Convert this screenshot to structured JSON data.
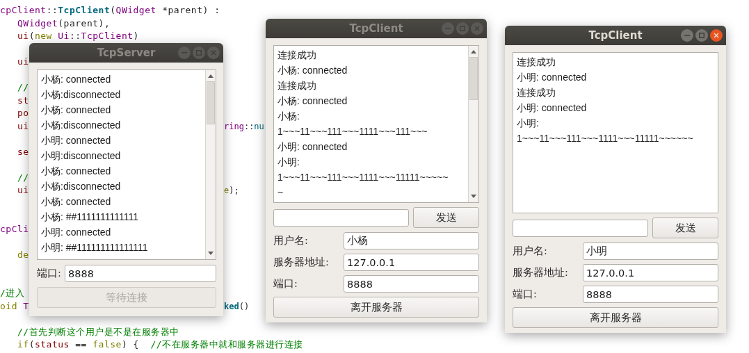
{
  "code_editor": {
    "lines": [
      {
        "kind": "code",
        "tokens": [
          {
            "text": "cpClient",
            "kind": "type"
          },
          {
            "text": "::",
            "kind": "plain"
          },
          {
            "text": "TcpClient",
            "kind": "func"
          },
          {
            "text": "(",
            "kind": "plain"
          },
          {
            "text": "QWidget",
            "kind": "type"
          },
          {
            "text": " *parent) :",
            "kind": "plain"
          }
        ]
      },
      {
        "kind": "code",
        "tokens": [
          {
            "text": "   QWidget",
            "kind": "type"
          },
          {
            "text": "(parent),",
            "kind": "plain"
          }
        ]
      },
      {
        "kind": "code",
        "tokens": [
          {
            "text": "   ui",
            "kind": "member"
          },
          {
            "text": "(",
            "kind": "plain"
          },
          {
            "text": "new ",
            "kind": "keyword"
          },
          {
            "text": "Ui",
            "kind": "type"
          },
          {
            "text": "::",
            "kind": "plain"
          },
          {
            "text": "TcpClient",
            "kind": "type"
          },
          {
            "text": ")",
            "kind": "plain"
          }
        ]
      },
      {
        "kind": "blank"
      },
      {
        "kind": "code",
        "tokens": [
          {
            "text": "   ui",
            "kind": "member"
          }
        ]
      },
      {
        "kind": "blank"
      },
      {
        "kind": "code",
        "tokens": [
          {
            "text": "   //",
            "kind": "comment"
          }
        ]
      },
      {
        "kind": "code",
        "tokens": [
          {
            "text": "   st",
            "kind": "member"
          }
        ]
      },
      {
        "kind": "code",
        "tokens": [
          {
            "text": "   po",
            "kind": "member"
          }
        ]
      },
      {
        "kind": "code",
        "tokens": [
          {
            "text": "   ui",
            "kind": "member"
          }
        ],
        "right_tokens": [
          {
            "text": "ring",
            "kind": "type"
          },
          {
            "text": "::",
            "kind": "plain"
          },
          {
            "text": "nu",
            "kind": "static"
          }
        ]
      },
      {
        "kind": "blank"
      },
      {
        "kind": "code",
        "tokens": [
          {
            "text": "   se",
            "kind": "member"
          }
        ]
      },
      {
        "kind": "blank"
      },
      {
        "kind": "code",
        "tokens": [
          {
            "text": "   //",
            "kind": "comment"
          }
        ]
      },
      {
        "kind": "code",
        "tokens": [
          {
            "text": "   ui",
            "kind": "member"
          }
        ],
        "right_tokens": [
          {
            "text": "e",
            "kind": "keyword"
          },
          {
            "text": ");",
            "kind": "plain"
          }
        ]
      },
      {
        "kind": "blank"
      },
      {
        "kind": "blank"
      },
      {
        "kind": "code",
        "tokens": [
          {
            "text": "cpCli",
            "kind": "type"
          }
        ]
      },
      {
        "kind": "blank"
      },
      {
        "kind": "code",
        "tokens": [
          {
            "text": "   de",
            "kind": "keyword"
          }
        ]
      },
      {
        "kind": "blank"
      },
      {
        "kind": "blank"
      },
      {
        "kind": "code",
        "tokens": [
          {
            "text": "/进入",
            "kind": "comment"
          }
        ]
      },
      {
        "kind": "code",
        "tokens": [
          {
            "text": "oid ",
            "kind": "keyword"
          },
          {
            "text": "T",
            "kind": "type"
          }
        ],
        "right_tokens": [
          {
            "text": "ked",
            "kind": "func"
          },
          {
            "text": "()",
            "kind": "plain"
          }
        ]
      },
      {
        "kind": "blank"
      },
      {
        "kind": "code",
        "tokens": [
          {
            "text": "   //首先判断这个用户是不是在服务器中",
            "kind": "comment"
          }
        ]
      },
      {
        "kind": "code",
        "tokens": [
          {
            "text": "   if",
            "kind": "keyword"
          },
          {
            "text": "(",
            "kind": "plain"
          },
          {
            "text": "status",
            "kind": "member"
          },
          {
            "text": " == ",
            "kind": "plain"
          },
          {
            "text": "false",
            "kind": "keyword"
          },
          {
            "text": ") {  ",
            "kind": "plain"
          },
          {
            "text": "//不在服务器中就和服务器进行连接",
            "kind": "comment"
          }
        ]
      }
    ]
  },
  "windows": [
    {
      "kind": "server",
      "title": "TcpServer",
      "active": false,
      "scrollable": true,
      "messages": [
        "小杨: connected",
        "小杨:disconnected",
        "小杨: connected",
        "小杨:disconnected",
        "小明: connected",
        "小明:disconnected",
        "小杨: connected",
        "小杨:disconnected",
        "小杨: connected",
        "小杨: ##1111111111111",
        "小明: connected",
        "小明: ##111111111111111"
      ],
      "fields": [
        {
          "label": "端口:",
          "value": "8888"
        }
      ],
      "button": {
        "label": "等待连接",
        "disabled": true
      }
    },
    {
      "kind": "client",
      "title": "TcpClient",
      "active": false,
      "scrollable": true,
      "messages": [
        "连接成功",
        "小杨: connected",
        "连接成功",
        "小杨: connected",
        "小杨:",
        "1~~~11~~~111~~~1111~~~111~~~",
        "小明: connected",
        "小明:",
        "1~~~11~~~111~~~1111~~~11111~~~~~",
        "~"
      ],
      "send_button": "发送",
      "fields": [
        {
          "label": "用户名:",
          "value": "小杨"
        },
        {
          "label": "服务器地址:",
          "value": "127.0.0.1"
        },
        {
          "label": "端口:",
          "value": "8888"
        }
      ],
      "button": {
        "label": "离开服务器",
        "disabled": false
      }
    },
    {
      "kind": "client",
      "title": "TcpClient",
      "active": true,
      "scrollable": false,
      "messages": [
        "连接成功",
        "小明: connected",
        "连接成功",
        "小明: connected",
        "小明:",
        "1~~~11~~~111~~~1111~~~11111~~~~~~"
      ],
      "send_button": "发送",
      "fields": [
        {
          "label": "用户名:",
          "value": "小明"
        },
        {
          "label": "服务器地址:",
          "value": "127.0.0.1"
        },
        {
          "label": "端口:",
          "value": "8888"
        }
      ],
      "button": {
        "label": "离开服务器",
        "disabled": false
      }
    }
  ]
}
